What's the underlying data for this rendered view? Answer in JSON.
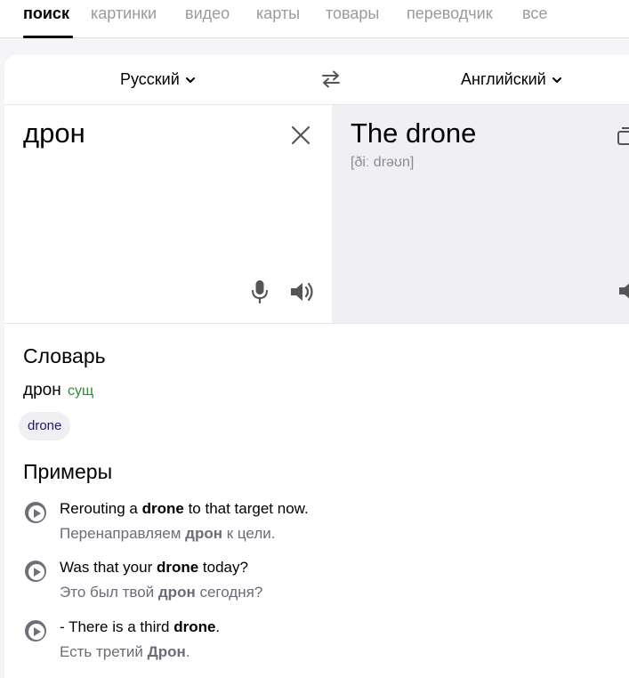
{
  "nav": {
    "items": [
      {
        "label": "поиск",
        "active": true
      },
      {
        "label": "картинки",
        "active": false
      },
      {
        "label": "видео",
        "active": false
      },
      {
        "label": "карты",
        "active": false
      },
      {
        "label": "товары",
        "active": false
      },
      {
        "label": "переводчик",
        "active": false
      },
      {
        "label": "все",
        "active": false
      }
    ]
  },
  "translator": {
    "source_lang": "Русский",
    "target_lang": "Английский",
    "source_text": "дрон",
    "target_text": "The drone",
    "transcription": "[ðiː drəʊn]"
  },
  "dictionary": {
    "heading": "Словарь",
    "word": "дрон",
    "pos": "сущ",
    "translation_chip": "drone"
  },
  "examples": {
    "heading": "Примеры",
    "items": [
      {
        "en_pre": "Rerouting a ",
        "en_bold": "drone",
        "en_post": " to that target now.",
        "ru_pre": "Перенаправляем ",
        "ru_bold": "дрон",
        "ru_post": " к цели."
      },
      {
        "en_pre": "Was that your ",
        "en_bold": "drone",
        "en_post": " today?",
        "ru_pre": "Это был твой ",
        "ru_bold": "дрон",
        "ru_post": " сегодня?"
      },
      {
        "en_pre": "- There is a third ",
        "en_bold": "drone",
        "en_post": ".",
        "ru_pre": "Есть третий ",
        "ru_bold": "Дрон",
        "ru_post": "."
      }
    ]
  },
  "colors": {
    "accent": "#000000",
    "pos": "#2f8a3b",
    "muted": "#8a8a95",
    "chip_text": "#1a1a6e"
  },
  "icons": [
    "chevron-down-icon",
    "swap-icon",
    "close-icon",
    "microphone-icon",
    "speaker-icon",
    "copy-icon",
    "play-icon"
  ]
}
